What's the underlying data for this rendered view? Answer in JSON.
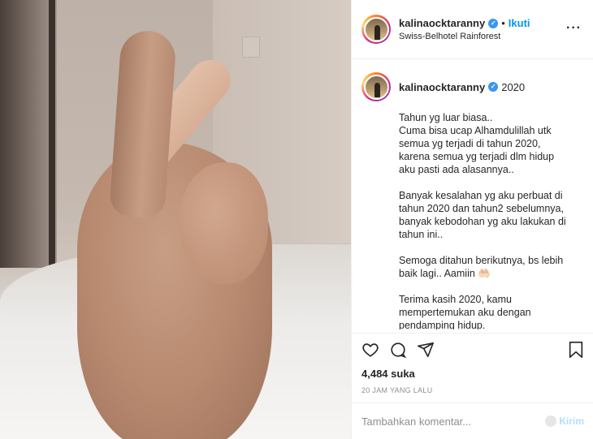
{
  "post": {
    "username": "kalinaocktaranny",
    "follow_label": "Ikuti",
    "location": "Swiss-Belhotel Rainforest",
    "caption_title": "2020",
    "caption_paragraphs": [
      [
        "Tahun yg luar biasa..",
        "Cuma bisa ucap Alhamdulillah utk",
        "semua yg terjadi di tahun 2020,",
        "karena semua yg terjadi dlm hidup",
        "aku pasti ada alasannya.."
      ],
      [
        "Banyak kesalahan yg aku perbuat di",
        "tahun 2020 dan tahun2 sebelumnya,",
        "banyak kebodohan yg aku lakukan di",
        "tahun ini.."
      ],
      [
        "Semoga ditahun berikutnya, bs lebih",
        "baik lagi.. Aamiin 🤲🏻"
      ],
      [
        "Terima kasih 2020, kamu",
        "mempertemukan aku dengan",
        "pendamping hidup."
      ]
    ],
    "likes": "4,484 suka",
    "timestamp": "20 JAM YANG LALU"
  },
  "comment": {
    "placeholder": "Tambahkan komentar...",
    "send_label": "Kirim"
  },
  "icons": {
    "like": "heart-icon",
    "comment": "comment-icon",
    "share": "send-icon",
    "save": "bookmark-icon",
    "more": "more-options-icon",
    "verified": "verified-badge-icon"
  },
  "colors": {
    "link": "#0095f6",
    "verified": "#3897f0",
    "muted": "#8e8e8e",
    "send_disabled": "#b2dffc"
  }
}
